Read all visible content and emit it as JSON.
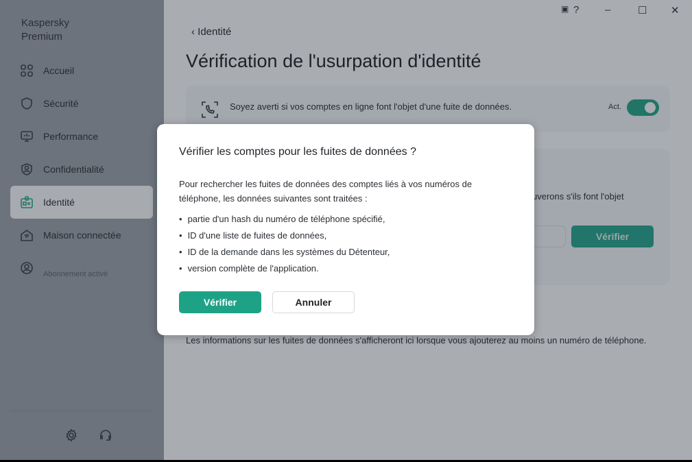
{
  "sidebar": {
    "brand": "Kaspersky Premium",
    "items": [
      {
        "label": "Accueil",
        "icon": "grid-icon"
      },
      {
        "label": "Sécurité",
        "icon": "shield-icon"
      },
      {
        "label": "Performance",
        "icon": "monitor-icon"
      },
      {
        "label": "Confidentialité",
        "icon": "privacy-shield-icon"
      },
      {
        "label": "Identité",
        "icon": "id-badge-icon",
        "active": true
      },
      {
        "label": "Maison connectée",
        "icon": "smart-home-icon"
      }
    ],
    "account_status": "Abonnement activé"
  },
  "window": {
    "help": "?",
    "minimize": "–",
    "maximize": "☐",
    "close": "✕"
  },
  "header": {
    "breadcrumb": "Identité",
    "title": "Vérification de l'usurpation d'identité"
  },
  "card1": {
    "text": "Soyez averti si vos comptes en ligne font l'objet d'une fuite de données.",
    "toggle_label": "Act.",
    "toggle_on": true
  },
  "card2": {
    "partial_text": "uverons s'ils font l'objet",
    "button": "Vérifier"
  },
  "info": "Les informations sur les fuites de données s'afficheront ici lorsque vous ajouterez au moins un numéro de téléphone.",
  "dialog": {
    "title": "Vérifier les comptes pour les fuites de données ?",
    "body": "Pour rechercher les fuites de données des comptes liés à vos numéros de téléphone, les données suivantes sont traitées :",
    "items": [
      "partie d'un hash du numéro de téléphone spécifié,",
      "ID d'une liste de fuites de données,",
      "ID de la demande dans les systèmes du Détenteur,",
      "version complète de l'application."
    ],
    "confirm": "Vérifier",
    "cancel": "Annuler"
  },
  "colors": {
    "accent": "#1ea286",
    "toggle": "#217566"
  }
}
